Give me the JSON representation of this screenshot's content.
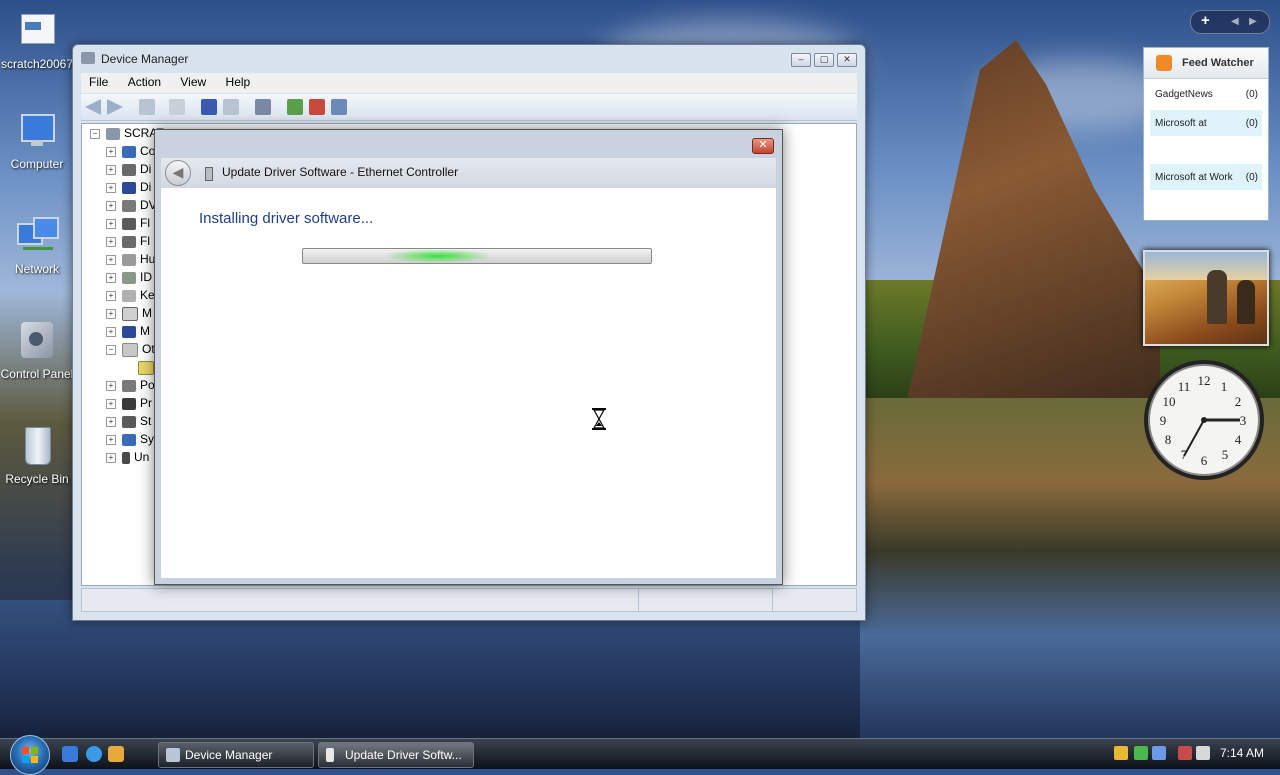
{
  "desktop": {
    "icons": [
      {
        "label": "scratch20067"
      },
      {
        "label": "Computer"
      },
      {
        "label": "Network"
      },
      {
        "label": "Control Panel"
      },
      {
        "label": "Recycle Bin"
      }
    ]
  },
  "device_manager": {
    "title": "Device Manager",
    "menu": [
      "File",
      "Action",
      "View",
      "Help"
    ],
    "tree_root": "SCRAT",
    "tree_items": [
      "Co",
      "Di",
      "Di",
      "DV",
      "Fl",
      "Fl",
      "Hu",
      "ID",
      "Ke",
      "M",
      "M",
      "Ot",
      "Po",
      "Pr",
      "St",
      "Sy",
      "Un"
    ]
  },
  "update_driver": {
    "title": "Update Driver Software - Ethernet Controller",
    "status": "Installing driver software...",
    "close_symbol": "✕",
    "back_symbol": "◀"
  },
  "gadgets": {
    "feed_watcher": {
      "title": "Feed Watcher",
      "items": [
        {
          "label": "GadgetNews",
          "count": "(0)"
        },
        {
          "label": "Microsoft at",
          "count": "(0)"
        },
        {
          "label": "Microsoft at Work",
          "count": "(0)"
        }
      ]
    },
    "sidebar_add": "+",
    "clock_numbers": [
      "12",
      "1",
      "2",
      "3",
      "4",
      "5",
      "6",
      "7",
      "8",
      "9",
      "10",
      "11"
    ]
  },
  "taskbar": {
    "buttons": [
      {
        "label": "Device Manager"
      },
      {
        "label": "Update Driver Softw..."
      }
    ],
    "time": "7:14 AM"
  },
  "colors": {
    "accent": "#1e3d8a",
    "progress_glow": "#3ce03c",
    "feed_highlight": "#dff3fb"
  }
}
